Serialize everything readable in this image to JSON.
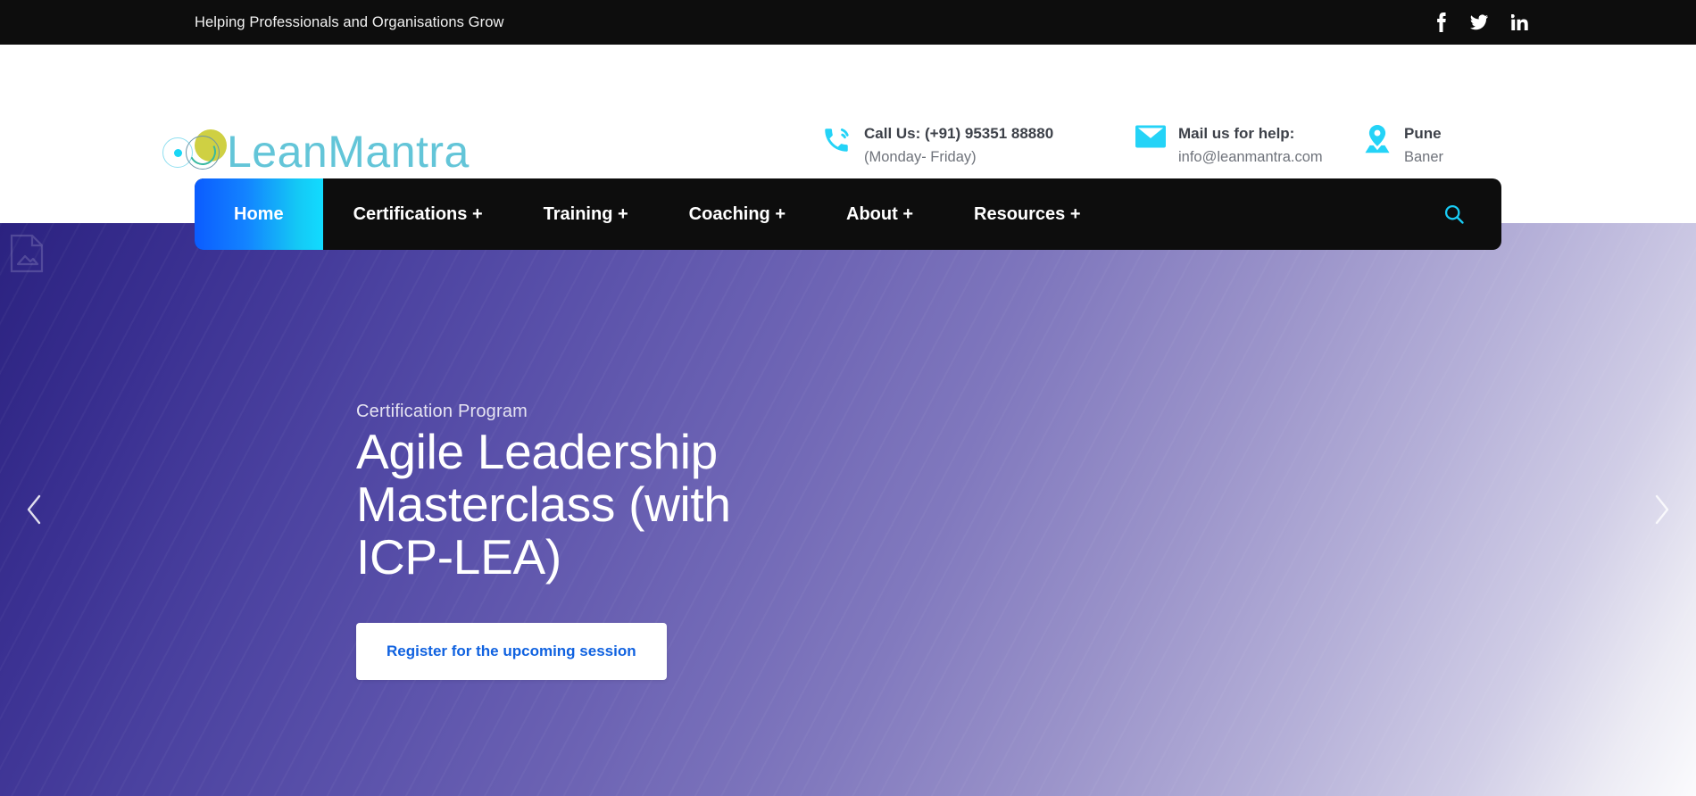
{
  "topbar": {
    "tagline": "Helping Professionals and Organisations Grow",
    "social": [
      {
        "name": "facebook-icon",
        "label": "Facebook"
      },
      {
        "name": "twitter-icon",
        "label": "Twitter"
      },
      {
        "name": "linkedin-icon",
        "label": "LinkedIn"
      }
    ]
  },
  "header": {
    "logo_text": "LeanMantra",
    "contacts": [
      {
        "icon": "phone-icon",
        "title": "Call Us: (+91) 95351 88880",
        "sub": "(Monday- Friday)"
      },
      {
        "icon": "mail-icon",
        "title": "Mail us for help:",
        "sub": "info@leanmantra.com"
      },
      {
        "icon": "map-pin-icon",
        "title": "Pune",
        "sub": "Baner"
      }
    ]
  },
  "nav": {
    "items": [
      {
        "label": "Home",
        "active": true
      },
      {
        "label": "Certifications +",
        "active": false
      },
      {
        "label": "Training +",
        "active": false
      },
      {
        "label": "Coaching +",
        "active": false
      },
      {
        "label": "About +",
        "active": false
      },
      {
        "label": "Resources +",
        "active": false
      }
    ],
    "search_icon": "search-icon"
  },
  "hero": {
    "eyebrow": "Certification Program",
    "title": "Agile Leadership Masterclass (with ICP-LEA)",
    "cta_label": "Register for the upcoming session",
    "prev_icon": "chevron-left-icon",
    "next_icon": "chevron-right-icon"
  },
  "colors": {
    "accent_cyan": "#24d3f7",
    "nav_black": "#0d0d0d",
    "logo_teal": "#63c5d8",
    "logo_yellow": "#cfd043",
    "cta_blue": "#1062e0",
    "hero_dark": "#2b2280",
    "hero_light": "#fbfbfd"
  }
}
